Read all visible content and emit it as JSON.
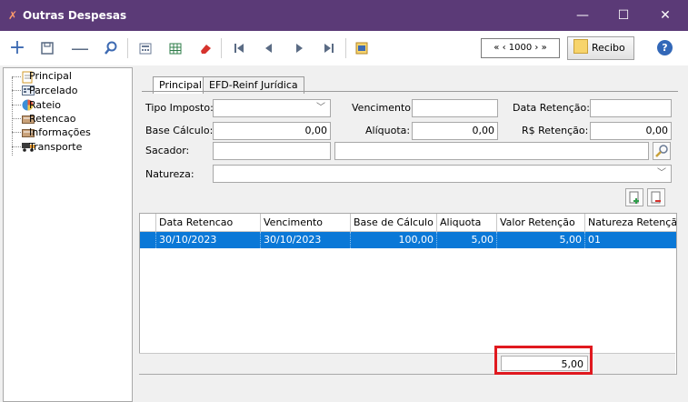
{
  "window": {
    "title": "Outras Despesas",
    "minimize": "—",
    "maximize": "☐",
    "close": "✕"
  },
  "toolbar": {
    "icons": [
      "plus-icon",
      "save-icon",
      "minus-icon",
      "search-icon",
      "calculator-icon",
      "table-icon",
      "eraser-icon",
      "first-icon",
      "prev-icon",
      "next-icon",
      "last-icon",
      "notebook-icon"
    ],
    "pager": "« ‹ 1000 › »",
    "recibo": "Recibo",
    "help": "?"
  },
  "tree": {
    "items": [
      {
        "label": "Principal",
        "icon": "document-icon"
      },
      {
        "label": "Parcelado",
        "icon": "calendar-icon"
      },
      {
        "label": "Rateio",
        "icon": "pie-icon"
      },
      {
        "label": "Retencao",
        "icon": "form-icon"
      },
      {
        "label": "Informações",
        "icon": "form-icon"
      },
      {
        "label": "Transporte",
        "icon": "truck-icon"
      }
    ]
  },
  "tabs": [
    {
      "label": "Principal",
      "active": true
    },
    {
      "label": "EFD-Reinf  Jurídica",
      "active": false
    }
  ],
  "form": {
    "tipo_imposto_label": "Tipo Imposto:",
    "tipo_imposto_value": "",
    "vencimento_label": "Vencimento:",
    "vencimento_value": "",
    "data_retencao_label": "Data Retenção:",
    "data_retencao_value": "",
    "base_calculo_label": "Base Cálculo:",
    "base_calculo_value": "0,00",
    "aliquota_label": "Alíquota:",
    "aliquota_value": "0,00",
    "rs_retencao_label": "R$ Retenção:",
    "rs_retencao_value": "0,00",
    "sacador_label": "Sacador:",
    "natureza_label": "Natureza:"
  },
  "grid": {
    "columns": [
      "Data Retencao",
      "Vencimento",
      "Base de Cálculo",
      "Aliquota",
      "Valor Retenção",
      "Natureza Retençã"
    ],
    "rows": [
      [
        "30/10/2023",
        "30/10/2023",
        "100,00",
        "5,00",
        "5,00",
        "01"
      ]
    ],
    "footer_total": "5,00"
  },
  "colors": {
    "titlebar": "#5b3a77",
    "selection": "#0a78d7",
    "highlight": "#e0191f"
  }
}
